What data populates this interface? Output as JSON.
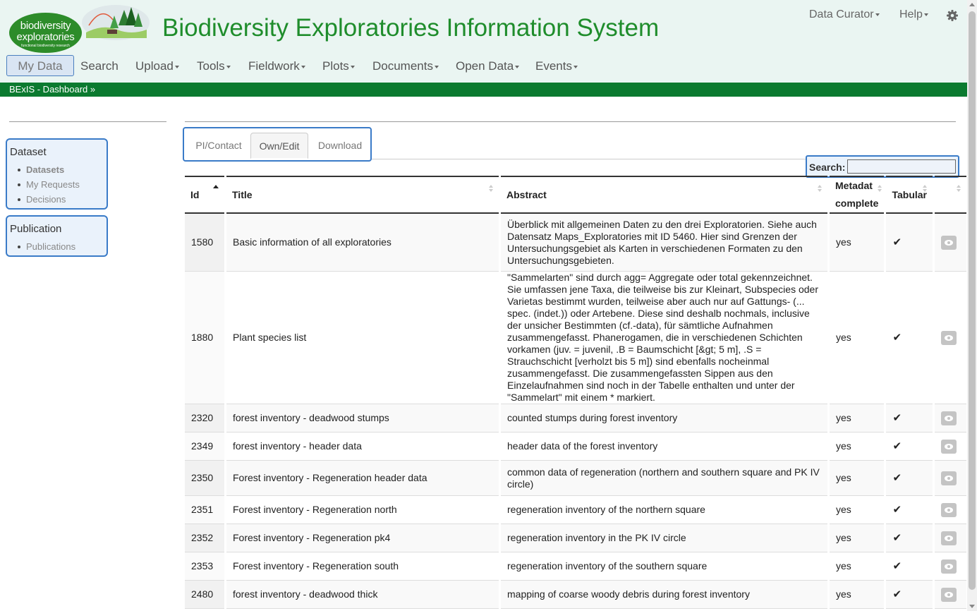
{
  "logo": {
    "line1": "biodiversity",
    "line2": "exploratories",
    "line3": "functional biodiversity research"
  },
  "app_title": "Biodiversity Exploratories Information System",
  "top_menu": {
    "user": "Data Curator",
    "help": "Help"
  },
  "nav": {
    "mydata": "My Data",
    "search": "Search",
    "upload": "Upload",
    "tools": "Tools",
    "fieldwork": "Fieldwork",
    "plots": "Plots",
    "documents": "Documents",
    "opendata": "Open Data",
    "events": "Events"
  },
  "breadcrumb": "BExIS - Dashboard »",
  "sidebar": {
    "dataset": {
      "title": "Dataset",
      "items": [
        "Datasets",
        "My Requests",
        "Decisions"
      ]
    },
    "publication": {
      "title": "Publication",
      "items": [
        "Publications"
      ]
    }
  },
  "tabs": [
    "PI/Contact",
    "Own/Edit",
    "Download"
  ],
  "search": {
    "label": "Search:",
    "value": ""
  },
  "table": {
    "headers": {
      "id": "Id",
      "title": "Title",
      "abstract": "Abstract",
      "metadata_1": "Metadat",
      "metadata_2": "complete",
      "tabular": "Tabular"
    },
    "rows": [
      {
        "id": "1580",
        "title": "Basic information of all exploratories",
        "abstract": "Überblick mit allgemeinen Daten zu den drei Exploratorien. Siehe auch Datensatz Maps_Exploratories mit ID 5460. Hier sind Grenzen der Untersuchungsgebiet als Karten in verschiedenen Formaten zu den Untersuchungsgebieten.",
        "metadata": "yes",
        "tabular": "✔"
      },
      {
        "id": "1880",
        "title": "Plant species list",
        "abstract": "\"Sammelarten\" sind durch agg= Aggregate oder total gekennzeichnet. Sie umfassen jene Taxa, die teilweise bis zur Kleinart, Subspecies oder Varietas bestimmt wurden, teilweise aber auch nur auf Gattungs- (... spec. (indet.)) oder Artebene. Diese sind deshalb nochmals, inclusive der unsicher Bestimmten (cf.-data), für sämtliche Aufnahmen zusammengefasst. Phanerogamen, die in verschiedenen Schichten vorkamen (juv. = juvenil, .B = Baumschicht [&gt; 5 m], .S = Strauchschicht [verholzt bis 5 m]) sind ebenfalls nocheinmal zusammengefasst. Die zusammengefassten Sippen aus den Einzelaufnahmen sind noch in der Tabelle enthalten und unter der \"Sammelart\" mit einem * markiert.",
        "metadata": "yes",
        "tabular": "✔"
      },
      {
        "id": "2320",
        "title": "forest inventory - deadwood stumps",
        "abstract": "counted stumps during forest inventory",
        "metadata": "yes",
        "tabular": "✔"
      },
      {
        "id": "2349",
        "title": "forest inventory - header data",
        "abstract": "header data of the forest inventory",
        "metadata": "yes",
        "tabular": "✔"
      },
      {
        "id": "2350",
        "title": "Forest inventory - Regeneration header data",
        "abstract": "common data of regeneration (northern and southern square and PK IV circle)",
        "metadata": "yes",
        "tabular": "✔"
      },
      {
        "id": "2351",
        "title": "Forest inventory - Regeneration north",
        "abstract": "regeneration inventory of the northern square",
        "metadata": "yes",
        "tabular": "✔"
      },
      {
        "id": "2352",
        "title": "Forest inventory - Regeneration pk4",
        "abstract": "regeneration inventory in the PK IV circle",
        "metadata": "yes",
        "tabular": "✔"
      },
      {
        "id": "2353",
        "title": "Forest inventory - Regeneration south",
        "abstract": "regeneration inventory of the southern square",
        "metadata": "yes",
        "tabular": "✔"
      },
      {
        "id": "2480",
        "title": "forest inventory - deadwood thick",
        "abstract": "mapping of coarse woody debris during forest inventory",
        "metadata": "yes",
        "tabular": "✔"
      }
    ]
  },
  "colors": {
    "brand_green": "#1f8d2c",
    "bar_green": "#0b7a2f",
    "focus_blue": "#3a7bc8"
  },
  "icons": {
    "settings": "gear-icon",
    "view": "eye-icon",
    "tabular": "check-icon"
  }
}
